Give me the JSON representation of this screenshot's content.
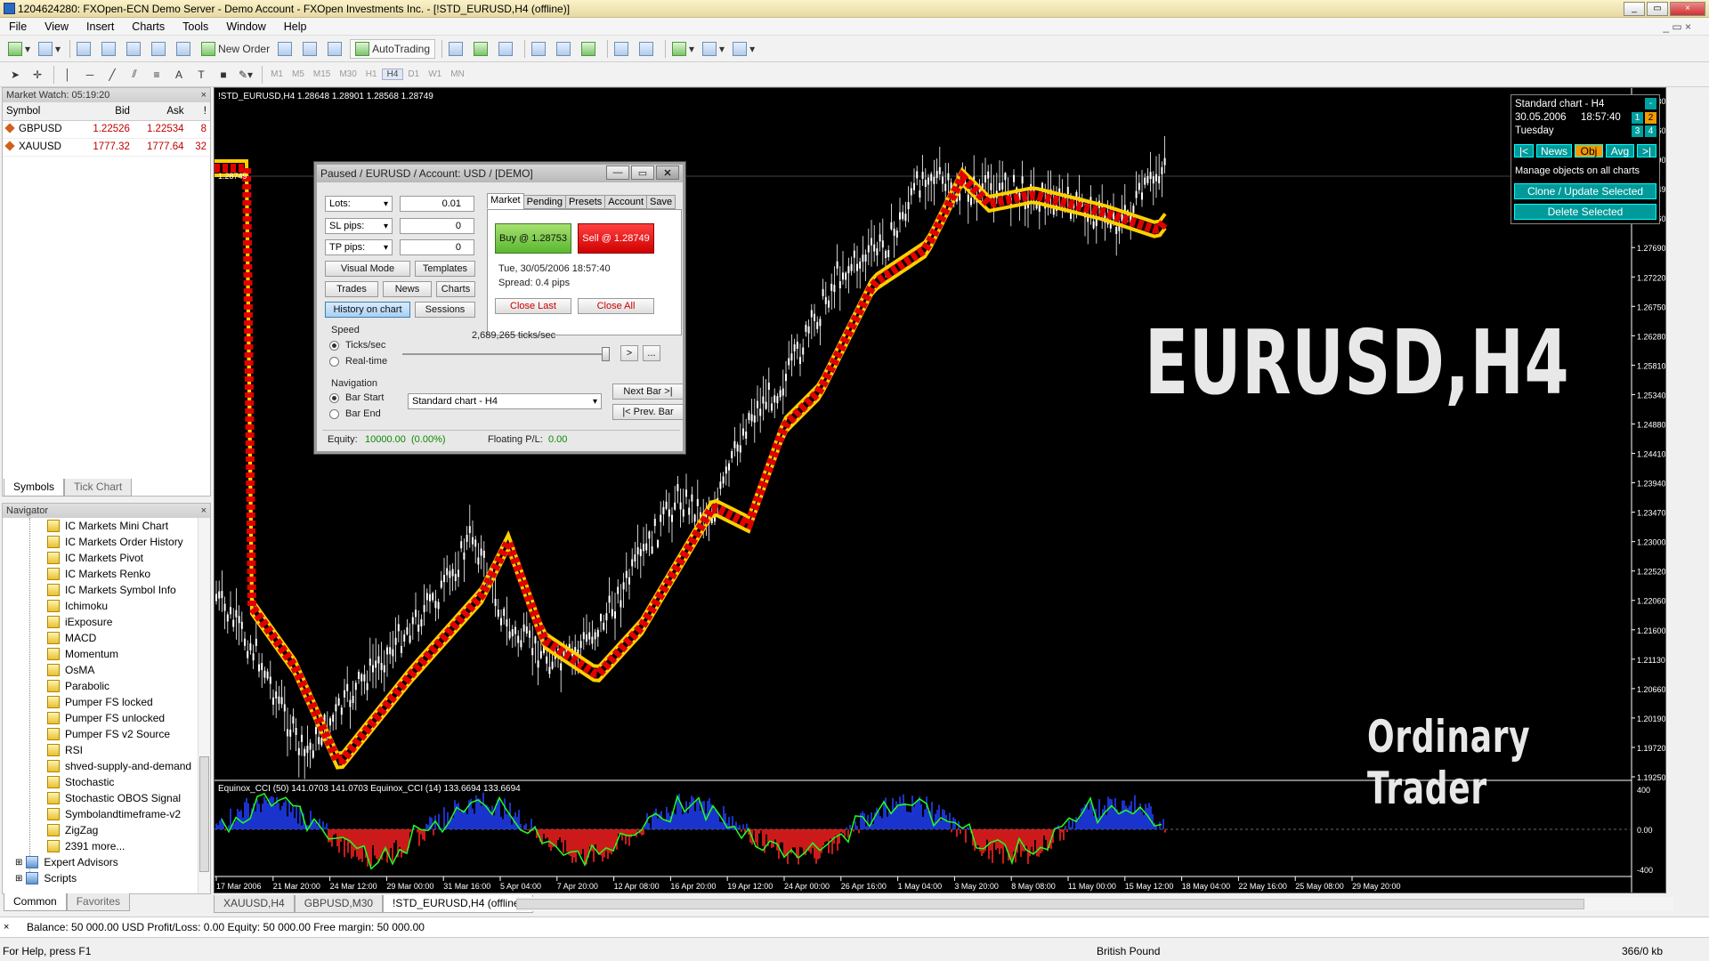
{
  "window": {
    "title": "1204624280: FXOpen-ECN Demo Server - Demo Account - FXOpen Investments Inc. - [!STD_EURUSD,H4 (offline)]",
    "buttons": [
      "_",
      "▭",
      "×"
    ]
  },
  "menu": [
    "File",
    "View",
    "Insert",
    "Charts",
    "Tools",
    "Window",
    "Help"
  ],
  "toolbar": {
    "new_order": "New Order",
    "auto_trading": "AutoTrading",
    "timeframes": [
      "M1",
      "M5",
      "M15",
      "M30",
      "H1",
      "H4",
      "D1",
      "W1",
      "MN"
    ],
    "active_tf": "H4"
  },
  "market_watch": {
    "title": "Market Watch: 05:19:20",
    "cols": [
      "Symbol",
      "Bid",
      "Ask",
      "!"
    ],
    "rows": [
      {
        "symbol": "GBPUSD",
        "bid": "1.22526",
        "ask": "1.22534",
        "spread": "8"
      },
      {
        "symbol": "XAUUSD",
        "bid": "1777.32",
        "ask": "1777.64",
        "spread": "32"
      }
    ],
    "tabs": [
      "Symbols",
      "Tick Chart"
    ]
  },
  "navigator": {
    "title": "Navigator",
    "items": [
      "IC Markets Mini Chart",
      "IC Markets Order History",
      "IC Markets Pivot",
      "IC Markets Renko",
      "IC Markets Symbol Info",
      "Ichimoku",
      "iExposure",
      "MACD",
      "Momentum",
      "OsMA",
      "Parabolic",
      "Pumper FS locked",
      "Pumper FS unlocked",
      "Pumper FS v2 Source",
      "RSI",
      "shved-supply-and-demand",
      "Stochastic",
      "Stochastic OBOS Signal",
      "Symbolandtimeframe-v2",
      "ZigZag",
      "2391 more..."
    ],
    "folders": [
      "Expert Advisors",
      "Scripts"
    ],
    "tabs": [
      "Common",
      "Favorites"
    ]
  },
  "chart": {
    "title": "!STD_EURUSD,H4  1.28648 1.28901 1.28568 1.28749",
    "price_tag": "1.28749",
    "big_title": "EURUSD,H4",
    "watermark": "Ordinary Trader",
    "subwindow": "Equinox_CCI (50) 141.0703 141.0703  Equinox_CCI (14) 133.6694 133.6694",
    "sub_axis": [
      "400",
      "0.00",
      "-400"
    ],
    "yaxis": [
      "1.30030",
      "1.29560",
      "1.29090",
      "1.28749",
      "1.28160",
      "1.27690",
      "1.27220",
      "1.26750",
      "1.26280",
      "1.25810",
      "1.25340",
      "1.24880",
      "1.24410",
      "1.23940",
      "1.23470",
      "1.23000",
      "1.22520",
      "1.22060",
      "1.21600",
      "1.21130",
      "1.20660",
      "1.20190",
      "1.19720",
      "1.19250"
    ],
    "xaxis": [
      "17 Mar 2006",
      "21 Mar 20:00",
      "24 Mar 12:00",
      "29 Mar 00:00",
      "31 Mar 16:00",
      "5 Apr 04:00",
      "7 Apr 20:00",
      "12 Apr 08:00",
      "16 Apr 20:00",
      "19 Apr 12:00",
      "24 Apr 00:00",
      "26 Apr 16:00",
      "1 May 04:00",
      "3 May 20:00",
      "8 May 08:00",
      "11 May 00:00",
      "15 May 12:00",
      "18 May 04:00",
      "22 May 16:00",
      "25 May 08:00",
      "29 May 20:00"
    ],
    "colors": {
      "bull": "#ffffff",
      "band_outer": "#ffd000",
      "band_inner": "#e00000",
      "cci_line": "#20ff20",
      "hist_pos": "#2040ff",
      "hist_neg": "#ff2020"
    }
  },
  "info_panel": {
    "line1": "Standard chart - H4",
    "date": "30.05.2006",
    "time": "18:57:40",
    "day": "Tuesday",
    "n1": "1",
    "n2": "2",
    "n3": "3",
    "n4": "4",
    "nav_first": "|<",
    "news": "News",
    "obj": "Obj",
    "avg": "Avg",
    "nav_last": ">|",
    "manage": "Manage objects on all charts",
    "clone": "Clone / Update Selected",
    "del": "Delete Selected"
  },
  "tester": {
    "title": "Paused / EURUSD / Account: USD / [DEMO]",
    "lots_label": "Lots:",
    "lots": "0.01",
    "sl_label": "SL pips:",
    "sl": "0",
    "tp_label": "TP pips:",
    "tp": "0",
    "btn_visual": "Visual Mode",
    "btn_templates": "Templates",
    "btn_trades": "Trades",
    "btn_news": "News",
    "btn_charts": "Charts",
    "btn_history": "History on chart",
    "btn_sessions": "Sessions",
    "tabs": [
      "Market",
      "Pending",
      "Presets",
      "Account",
      "Save"
    ],
    "buy": "Buy @ 1.28753",
    "sell": "Sell @ 1.28749",
    "datetime": "Tue, 30/05/2006  18:57:40",
    "spread": "Spread: 0.4 pips",
    "close_last": "Close Last",
    "close_all": "Close All",
    "speed_label": "Speed",
    "ticks": "Ticks/sec",
    "realtime": "Real-time",
    "speed_val": "2,689,265 ticks/sec",
    "play": ">",
    "more": "...",
    "nav_label": "Navigation",
    "bar_start": "Bar Start",
    "bar_end": "Bar End",
    "chart_sel": "Standard chart - H4",
    "next_bar": "Next Bar >|",
    "prev_bar": "|< Prev. Bar",
    "equity_label": "Equity:",
    "equity": "10000.00",
    "equity_pct": "(0.00%)",
    "fpl_label": "Floating P/L:",
    "fpl": "0.00"
  },
  "chart_tabs": [
    "XAUUSD,H4",
    "GBPUSD,M30",
    "!STD_EURUSD,H4 (offline)"
  ],
  "terminal": "Balance: 50 000.00 USD  Profit/Loss: 0.00  Equity: 50 000.00  Free margin: 50 000.00",
  "status": {
    "help": "For Help, press F1",
    "profile": "British Pound",
    "traffic": "366/0 kb"
  }
}
